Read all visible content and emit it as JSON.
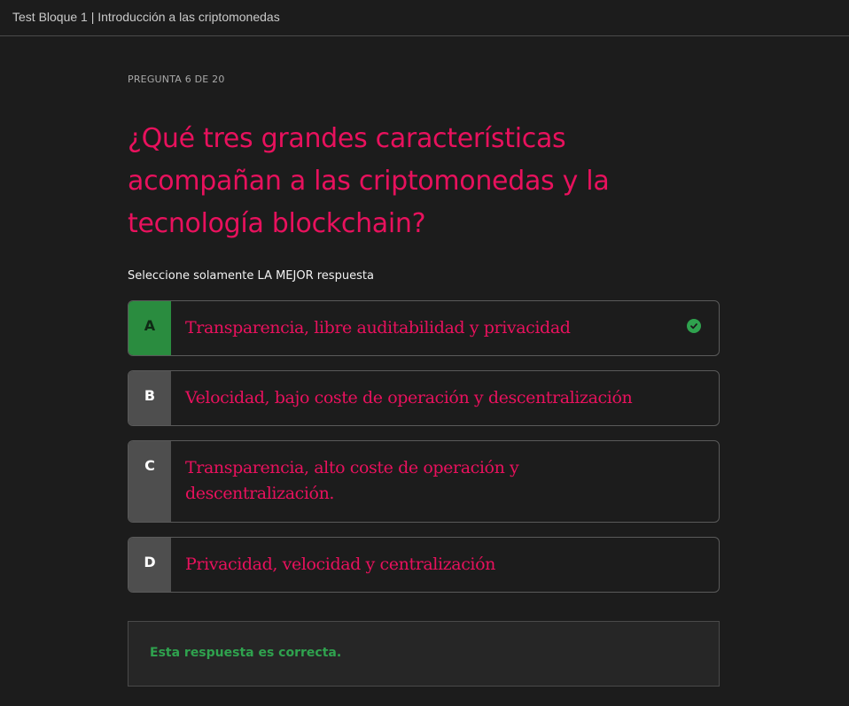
{
  "window": {
    "title": "Test Bloque 1 | Introducción a las criptomonedas"
  },
  "quiz": {
    "counter": "PREGUNTA 6 DE 20",
    "question": "¿Qué tres grandes características acompañan a las criptomonedas y la tecnología blockchain?",
    "instruction": "Seleccione solamente LA MEJOR respuesta",
    "options": [
      {
        "letter": "A",
        "text": "Transparencia, libre auditabilidad y privacidad",
        "state": "correct",
        "icon": "check-circle-icon"
      },
      {
        "letter": "B",
        "text": "Velocidad, bajo coste de operación y descentralización",
        "state": "default"
      },
      {
        "letter": "C",
        "text": "Transparencia, alto coste de operación y descentralización.",
        "state": "default"
      },
      {
        "letter": "D",
        "text": "Privacidad, velocidad y centralización",
        "state": "default"
      }
    ],
    "feedback": "Esta respuesta es correcta."
  },
  "colors": {
    "background": "#1c1c1c",
    "accent": "#e8115d",
    "correct": "#2a8c3f",
    "correct_text": "#2fa24e",
    "letter_box": "#4e4e4e"
  }
}
